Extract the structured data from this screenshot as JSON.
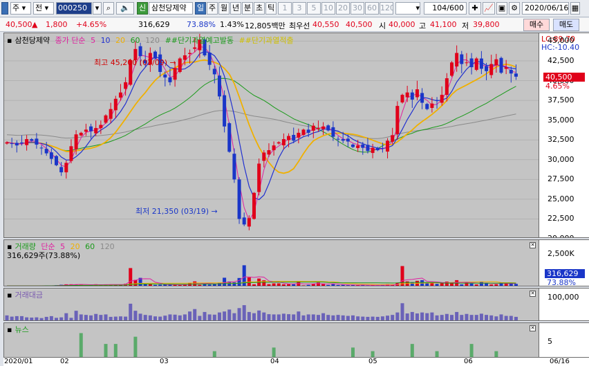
{
  "toolbar": {
    "period_type": "주",
    "prev_label": "전",
    "code": "000250",
    "credit_badge": "신",
    "stock_name": "삼천당제약",
    "period_tabs": [
      "일",
      "주",
      "월",
      "년",
      "분",
      "초",
      "틱"
    ],
    "interval_tabs": [
      "1",
      "3",
      "5",
      "10",
      "20",
      "30",
      "60",
      "120"
    ],
    "count": "104/600",
    "date": "2020/06/16"
  },
  "quote": {
    "price": "40,500",
    "arrow": "▲",
    "change": "1,800",
    "change_pct": "+4.65%",
    "volume": "316,629",
    "volume_ratio": "73.88%",
    "turnover": "1.43%",
    "amount": "12,805백만",
    "priority": "최우선",
    "bid": "40,550",
    "ask": "40,500",
    "open_label": "시",
    "open": "40,000",
    "high_label": "고",
    "high": "41,100",
    "low_label": "저",
    "low": "39,800",
    "buy_label": "매수",
    "sell_label": "매도"
  },
  "price_pane": {
    "name": "삼천당제약",
    "ma_label": "종가 단순",
    "ma_periods": [
      "5",
      "10",
      "20",
      "60",
      "120"
    ],
    "signal1": "##단기과열예고발동",
    "signal2": "##단기과열적출",
    "high_annotation": "최고 45,200 (03/09)",
    "low_annotation": "최저 21,350 (03/19)",
    "lc": "LC:89.70",
    "hc": "HC:-10.40",
    "current_price": "40,500",
    "current_pct": "4.65%",
    "axis_ticks": [
      "45,000",
      "42,500",
      "40,000",
      "37,500",
      "35,000",
      "32,500",
      "30,000",
      "27,500",
      "25,000",
      "22,500",
      "20,000"
    ]
  },
  "volume_pane": {
    "name": "거래량",
    "ma_label": "단순",
    "ma_periods": [
      "5",
      "20",
      "60",
      "120"
    ],
    "value": "316,629주(73.88%)",
    "axis_tick": "2,500K",
    "current_value": "316,629",
    "current_pct": "73.88%"
  },
  "amount_pane": {
    "name": "거래대금",
    "axis_tick": "100,000"
  },
  "news_pane": {
    "name": "뉴스",
    "axis_tick": "5"
  },
  "xaxis": {
    "labels": [
      "2020/01",
      "02",
      "03",
      "04",
      "05",
      "06"
    ],
    "end_label": "06/16"
  },
  "colors": {
    "up": "#e0001a",
    "down": "#1a36c8",
    "ma5": "#e020a0",
    "ma10": "#2030d0",
    "ma20": "#f0b000",
    "ma60": "#1a9a1a",
    "ma120": "#8a8a8a",
    "pane_bg": "#c4c4c4"
  },
  "chart_data": {
    "type": "candlestick",
    "closes": [
      32200,
      32000,
      31800,
      32100,
      32600,
      32400,
      31900,
      31500,
      30800,
      30100,
      29300,
      28400,
      29600,
      31700,
      33200,
      33400,
      33800,
      33600,
      34000,
      34400,
      35600,
      36400,
      37700,
      38500,
      39800,
      42600,
      44000,
      43100,
      42200,
      43500,
      42800,
      41100,
      40400,
      39800,
      41600,
      42800,
      43200,
      43500,
      44200,
      45200,
      43200,
      42000,
      40800,
      38000,
      34200,
      31000,
      27500,
      22500,
      21800,
      22600,
      25800,
      29500,
      30900,
      31200,
      31800,
      32200,
      32600,
      33000,
      32400,
      33400,
      33800,
      33400,
      34300,
      34000,
      34200,
      33700,
      32900,
      32600,
      32400,
      32300,
      31600,
      31800,
      31500,
      31100,
      31500,
      31200,
      31400,
      32400,
      33100,
      36800,
      38200,
      38500,
      37600,
      38900,
      37200,
      36400,
      37100,
      37500,
      38200,
      40300,
      42300,
      43500,
      42100,
      42300,
      41700,
      42800,
      41500,
      41200,
      42100,
      42700,
      41000,
      41700,
      40900,
      40500
    ],
    "value_range": [
      20000,
      46000
    ],
    "volume_range": [
      0,
      3300000
    ],
    "volume": [
      95000,
      84000,
      88000,
      102000,
      78000,
      96000,
      86000,
      111000,
      125000,
      105000,
      141000,
      180000,
      211000,
      214000,
      200000,
      193000,
      146000,
      140000,
      215000,
      197000,
      210000,
      180000,
      185000,
      184000,
      245000,
      1420000,
      540000,
      690000,
      230000,
      218000,
      165000,
      182000,
      219000,
      188000,
      175000,
      152000,
      204000,
      315000,
      430000,
      175000,
      240000,
      194000,
      220000,
      330000,
      700000,
      420000,
      360000,
      680000,
      1630000,
      720000,
      210000,
      640000,
      510000,
      220000,
      280000,
      280000,
      212000,
      220000,
      213000,
      460000,
      130000,
      168000,
      260000,
      340000,
      270000,
      160000,
      225000,
      160000,
      170000,
      142000,
      152000,
      142000,
      182000,
      120000,
      126000,
      116000,
      160000,
      220000,
      160000,
      340000,
      1570000,
      430000,
      360000,
      470000,
      520000,
      325000,
      370000,
      245000,
      290000,
      410000,
      320000,
      520000,
      205000,
      360000,
      270000,
      200000,
      405000,
      320000,
      196000,
      215000,
      340000,
      300000,
      275000,
      240000
    ],
    "amount_range": [
      0,
      125000
    ],
    "amount": [
      26000,
      21000,
      23000,
      23000,
      18000,
      17000,
      18000,
      15000,
      20000,
      23000,
      16000,
      18000,
      35000,
      16000,
      45000,
      30000,
      28000,
      26000,
      32000,
      28000,
      30000,
      20000,
      21000,
      22000,
      21000,
      74000,
      45000,
      33000,
      28000,
      26000,
      22000,
      21000,
      25000,
      30000,
      29000,
      26000,
      30000,
      42000,
      52000,
      24000,
      40000,
      30000,
      29000,
      38000,
      42000,
      50000,
      35000,
      56000,
      68000,
      40000,
      35000,
      46000,
      38000,
      31000,
      30000,
      30000,
      33000,
      31000,
      30000,
      42000,
      26000,
      30000,
      30000,
      28000,
      35000,
      28000,
      26000,
      28000,
      26000,
      24000,
      26000,
      22000,
      21000,
      20000,
      21000,
      20000,
      22000,
      25000,
      28000,
      38000,
      76000,
      34000,
      40000,
      34000,
      38000,
      35000,
      38000,
      26000,
      28000,
      32000,
      28000,
      40000,
      28000,
      32000,
      28000,
      28000,
      33000,
      28000,
      26000,
      22000,
      30000,
      24000,
      24000,
      20000
    ],
    "news_range": [
      0,
      9
    ],
    "news": [
      0,
      0,
      0,
      0,
      0,
      0,
      0,
      0,
      0,
      0,
      0,
      0,
      0,
      0,
      0,
      7,
      0,
      0,
      0,
      0,
      4,
      0,
      4,
      0,
      0,
      0,
      6,
      0,
      0,
      0,
      0,
      0,
      0,
      0,
      0,
      0,
      0,
      0,
      0,
      0,
      0,
      0,
      2,
      0,
      0,
      0,
      0,
      0,
      0,
      0,
      0,
      0,
      0,
      0,
      3,
      0,
      0,
      0,
      0,
      0,
      0,
      0,
      0,
      0,
      0,
      0,
      0,
      0,
      0,
      0,
      3,
      0,
      0,
      0,
      2,
      0,
      0,
      0,
      0,
      0,
      0,
      0,
      4,
      0,
      0,
      0,
      0,
      2,
      0,
      0,
      0,
      0,
      0,
      0,
      4,
      0,
      0,
      0,
      0,
      2,
      0,
      0,
      0,
      0
    ],
    "x_labels": [
      "2020/01",
      "02",
      "03",
      "04",
      "05",
      "06"
    ]
  }
}
